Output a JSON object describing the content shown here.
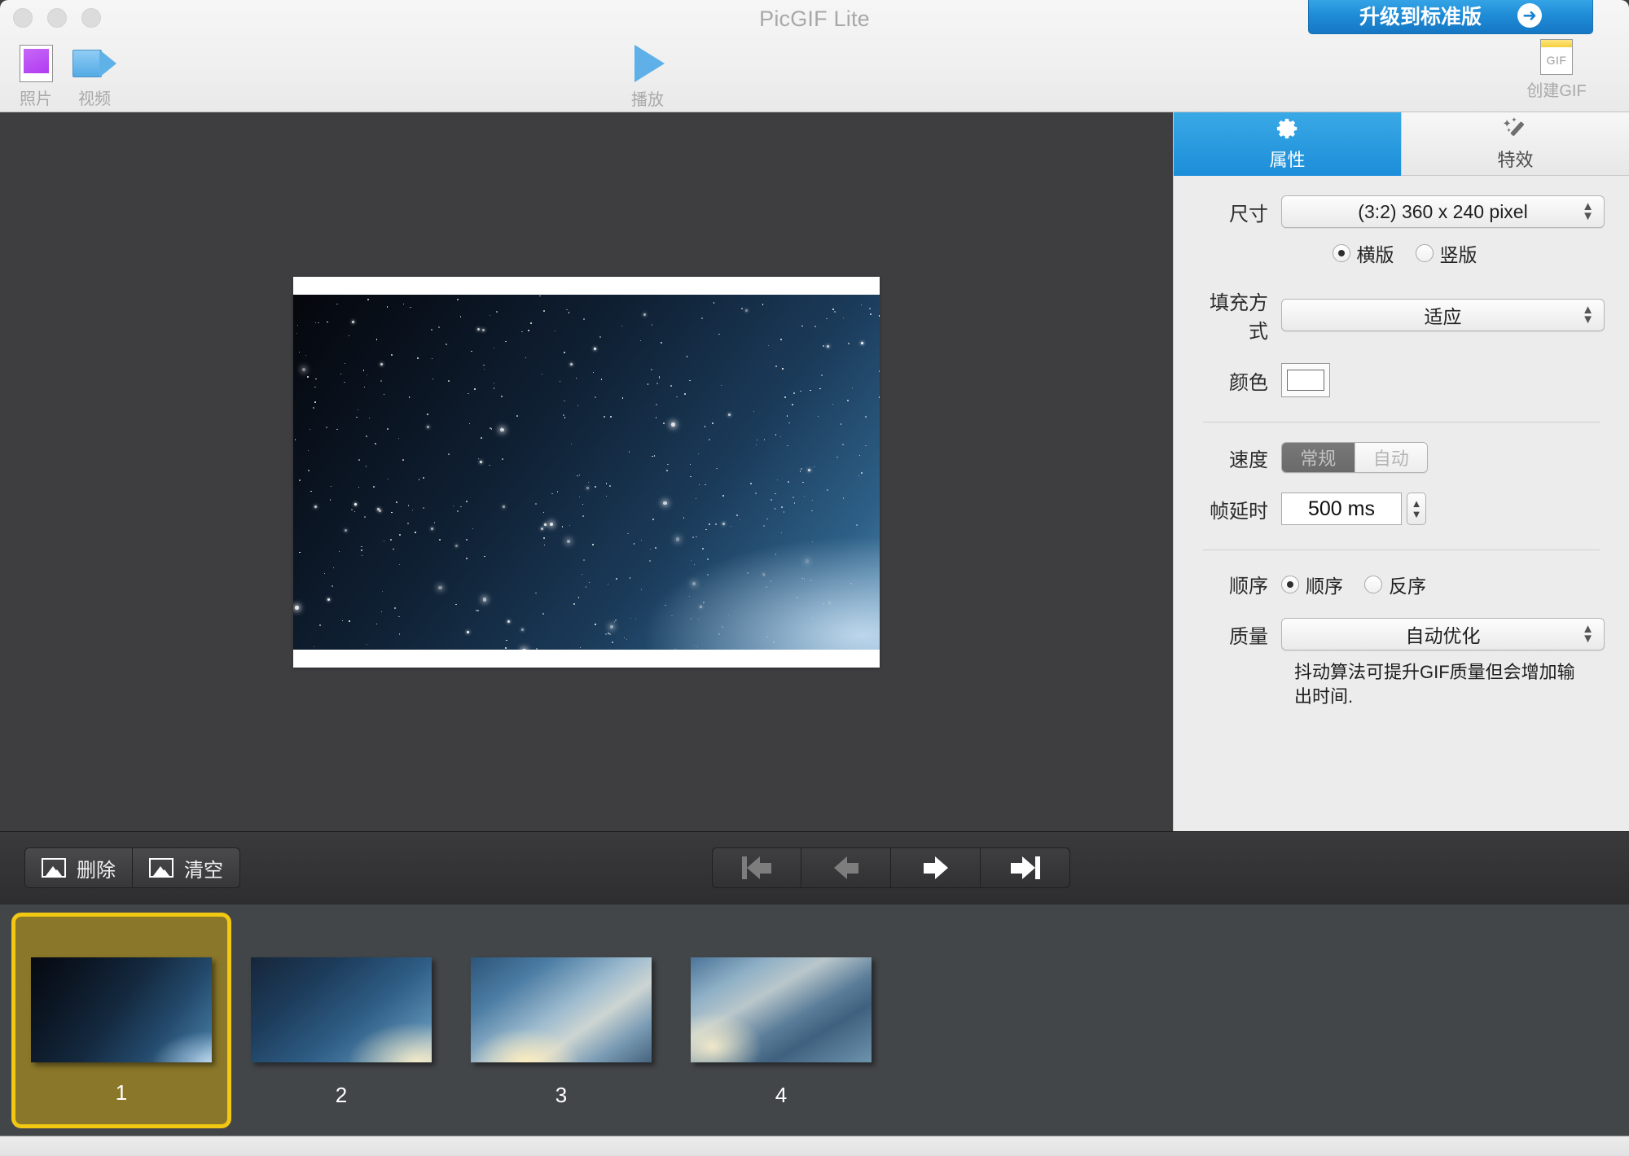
{
  "window": {
    "title": "PicGIF Lite",
    "traffic_lights": [
      "close",
      "minimize",
      "zoom"
    ]
  },
  "toolbar": {
    "photo": {
      "label": "照片",
      "icon": "photo-icon"
    },
    "video": {
      "label": "视频",
      "icon": "video-camera-icon"
    },
    "play": {
      "label": "播放",
      "icon": "play-triangle-icon"
    },
    "upgrade": {
      "label": "升级到标准版",
      "icon": "arrow-right-circle-icon"
    },
    "create_gif": {
      "label": "创建GIF",
      "icon": "gif-file-icon",
      "badge": "GIF"
    }
  },
  "panel": {
    "tabs": [
      {
        "label": "属性",
        "icon": "gear-icon",
        "active": true
      },
      {
        "label": "特效",
        "icon": "magic-wand-icon",
        "active": false
      }
    ],
    "size": {
      "label": "尺寸",
      "value": "(3:2) 360 x 240 pixel",
      "orientation": [
        {
          "label": "横版",
          "selected": true
        },
        {
          "label": "竖版",
          "selected": false
        }
      ]
    },
    "fill": {
      "label": "填充方式",
      "value": "适应"
    },
    "color": {
      "label": "颜色",
      "value": "#FFFFFF"
    },
    "speed": {
      "label": "速度",
      "options": [
        {
          "label": "常规",
          "selected": true
        },
        {
          "label": "自动",
          "selected": false
        }
      ]
    },
    "frame_delay": {
      "label": "帧延时",
      "value": "500 ms"
    },
    "order": {
      "label": "顺序",
      "options": [
        {
          "label": "顺序",
          "selected": true
        },
        {
          "label": "反序",
          "selected": false
        }
      ]
    },
    "quality": {
      "label": "质量",
      "value": "自动优化",
      "hint": "抖动算法可提升GIF质量但会增加输出时间."
    }
  },
  "bottom_toolbar": {
    "delete": {
      "label": "删除",
      "icon": "image-icon"
    },
    "clear": {
      "label": "清空",
      "icon": "image-icon"
    },
    "navigation": [
      {
        "name": "first-frame",
        "icon": "skip-back-icon",
        "enabled": false
      },
      {
        "name": "previous-frame",
        "icon": "arrow-left-icon",
        "enabled": false
      },
      {
        "name": "next-frame",
        "icon": "arrow-right-icon",
        "enabled": true
      },
      {
        "name": "last-frame",
        "icon": "skip-forward-icon",
        "enabled": true
      }
    ]
  },
  "frames": [
    {
      "number": "1",
      "selected": true,
      "sky": "sky1"
    },
    {
      "number": "2",
      "selected": false,
      "sky": "sky2"
    },
    {
      "number": "3",
      "selected": false,
      "sky": "sky3"
    },
    {
      "number": "4",
      "selected": false,
      "sky": "sky4"
    }
  ],
  "colors": {
    "accent_blue": "#1D8ED9",
    "upgrade_blue": "#1F8BD6",
    "selection_yellow": "#F2C812",
    "canvas_background": "#3E3E40",
    "panel_background": "#ECECEC",
    "thumbstrip_background": "#434649"
  }
}
